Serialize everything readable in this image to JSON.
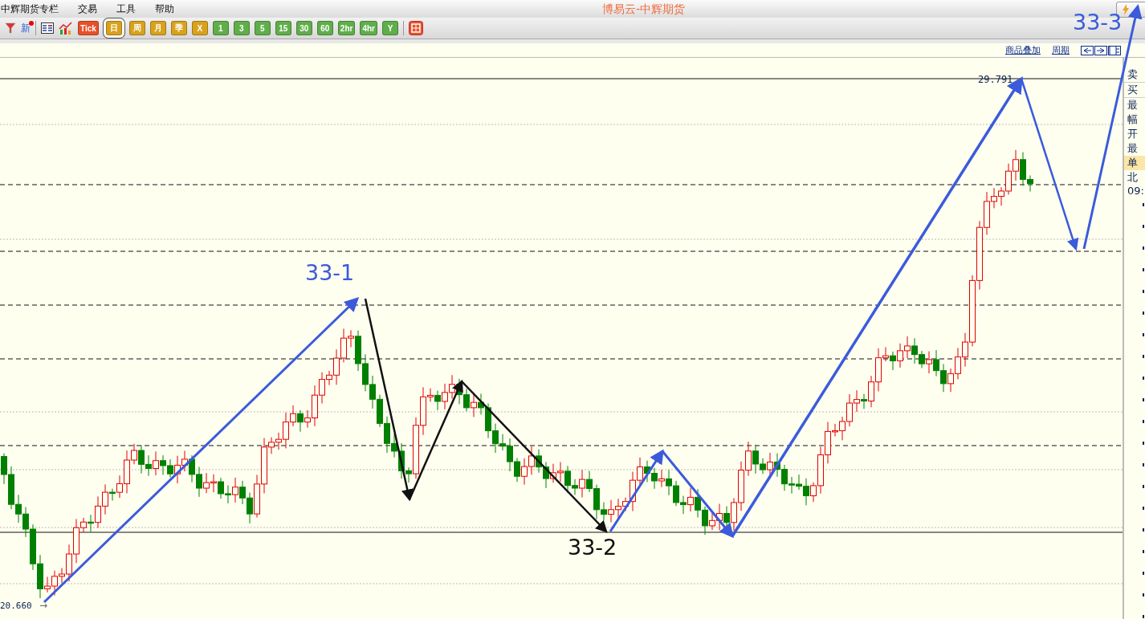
{
  "menu": {
    "items": [
      "中辉期货专栏",
      "交易",
      "工具",
      "帮助"
    ],
    "title": "博易云-中辉期货"
  },
  "toolbar": {
    "new_label": "新",
    "buttons": [
      {
        "label": "Tick",
        "color": "#e8502a",
        "selected": false
      },
      {
        "label": "日",
        "color": "#d9a21c",
        "selected": true
      },
      {
        "label": "周",
        "color": "#d9a21c",
        "selected": false
      },
      {
        "label": "月",
        "color": "#d9a21c",
        "selected": false
      },
      {
        "label": "季",
        "color": "#d9a21c",
        "selected": false
      },
      {
        "label": "X",
        "color": "#d9a21c",
        "selected": false
      },
      {
        "label": "1",
        "color": "#5fae4a",
        "selected": false
      },
      {
        "label": "3",
        "color": "#5fae4a",
        "selected": false
      },
      {
        "label": "5",
        "color": "#5fae4a",
        "selected": false
      },
      {
        "label": "15",
        "color": "#5fae4a",
        "selected": false
      },
      {
        "label": "30",
        "color": "#5fae4a",
        "selected": false
      },
      {
        "label": "60",
        "color": "#5fae4a",
        "selected": false
      },
      {
        "label": "2hr",
        "color": "#5fae4a",
        "selected": false
      },
      {
        "label": "4hr",
        "color": "#5fae4a",
        "selected": false
      },
      {
        "label": "Y",
        "color": "#5fae4a",
        "selected": false
      }
    ]
  },
  "chart_header": {
    "links": [
      "商品叠加",
      "周期"
    ]
  },
  "chart": {
    "high_label": "29.791",
    "low_label": "20.660",
    "low_arrow": "→",
    "annotations": [
      {
        "text": "33-1",
        "color": "#3b5bdb"
      },
      {
        "text": "33-2",
        "color": "#111111"
      },
      {
        "text": "33-3",
        "color": "#3b5bdb"
      }
    ]
  },
  "quote_panel": {
    "rows": [
      {
        "label": "卖",
        "highlighted": false
      },
      {
        "label": "买",
        "highlighted": false
      },
      {
        "label": "最",
        "highlighted": false
      },
      {
        "label": "幅",
        "highlighted": false
      },
      {
        "label": "开",
        "highlighted": false
      },
      {
        "label": "最",
        "highlighted": false
      },
      {
        "label": "单",
        "highlighted": true
      },
      {
        "label": "北",
        "highlighted": false
      },
      {
        "label": "09:",
        "highlighted": false
      }
    ]
  }
}
